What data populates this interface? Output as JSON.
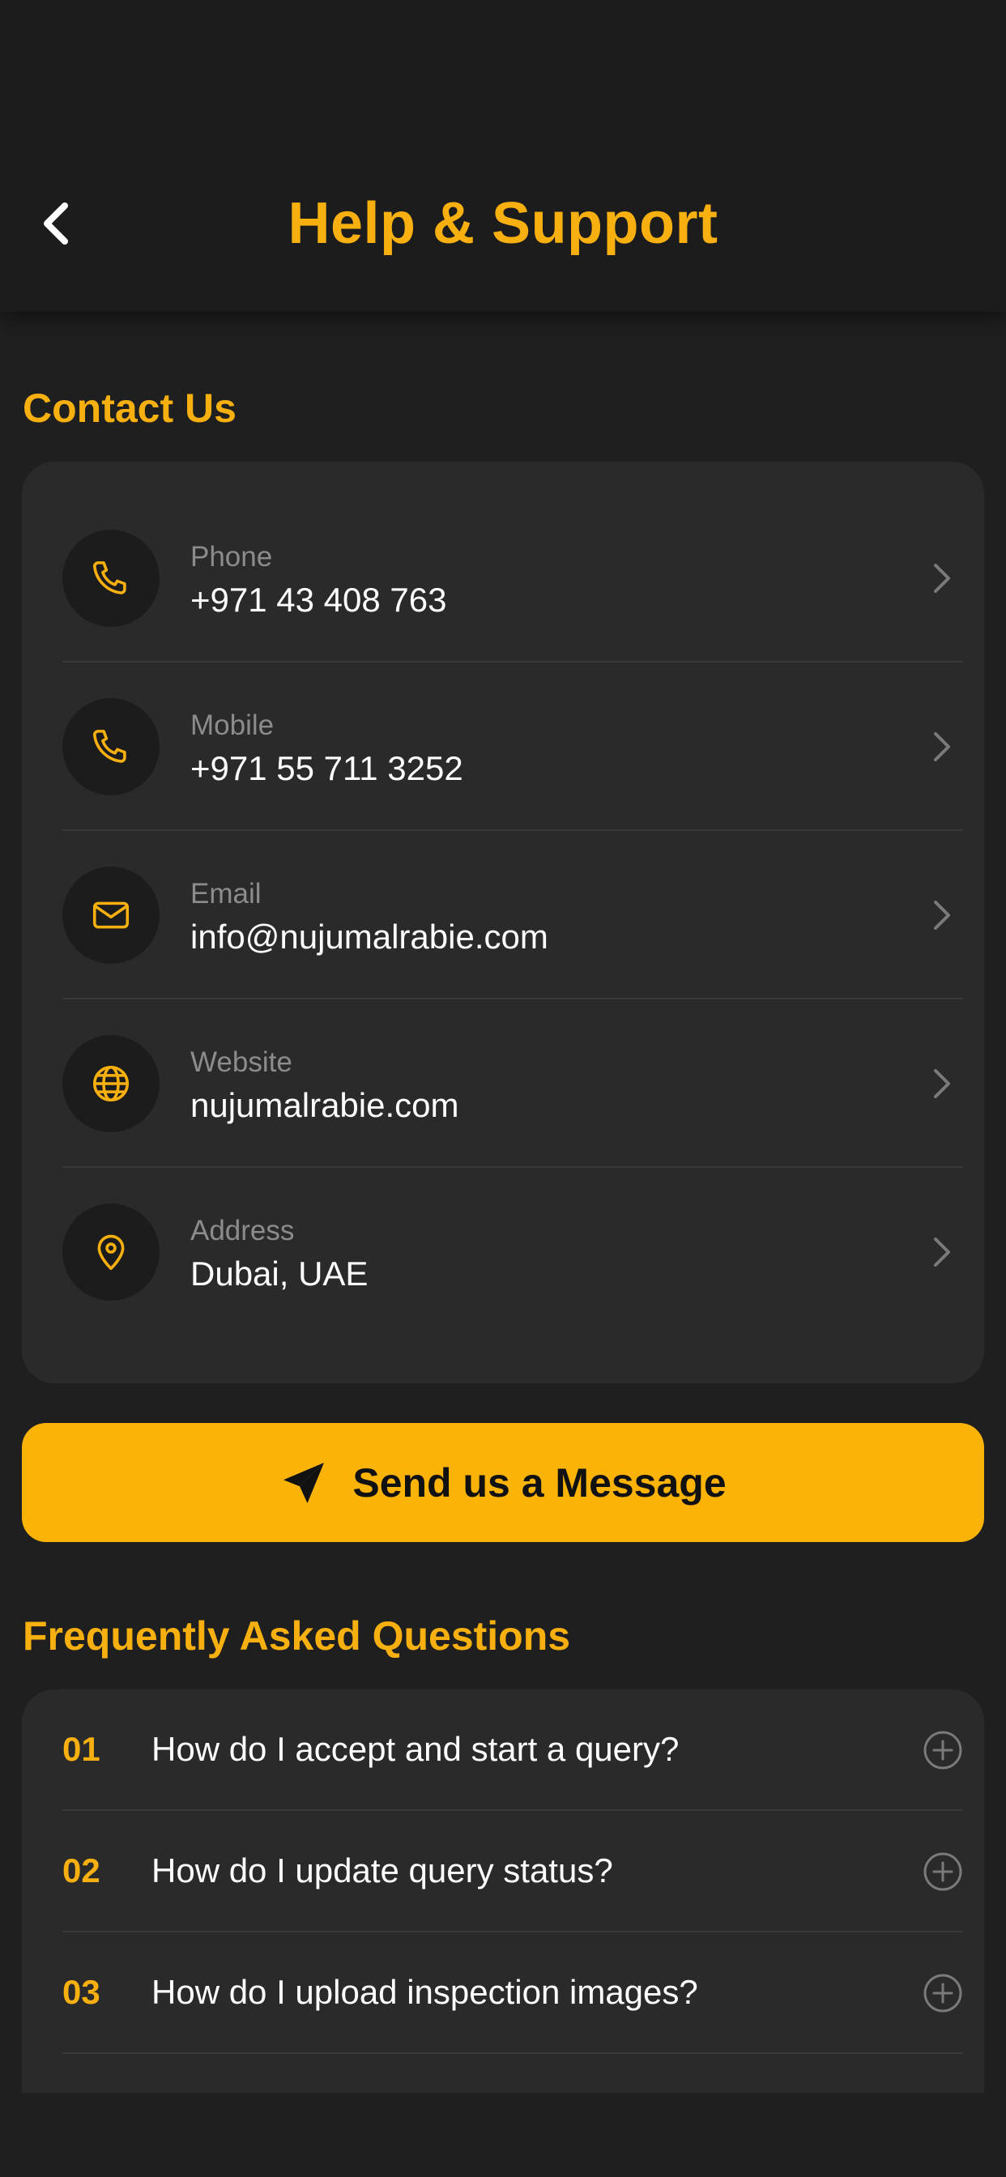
{
  "header": {
    "title": "Help & Support",
    "back_icon": "chevron-left-icon"
  },
  "contact": {
    "section_title": "Contact Us",
    "items": [
      {
        "label": "Phone",
        "value": "+971 43 408 763",
        "icon": "phone-icon"
      },
      {
        "label": "Mobile",
        "value": "+971 55 711 3252",
        "icon": "phone-icon"
      },
      {
        "label": "Email",
        "value": "info@nujumalrabie.com",
        "icon": "mail-icon"
      },
      {
        "label": "Website",
        "value": "nujumalrabie.com",
        "icon": "globe-icon"
      },
      {
        "label": "Address",
        "value": "Dubai, UAE",
        "icon": "location-pin-icon"
      }
    ]
  },
  "send_button": {
    "label": "Send us a Message",
    "icon": "send-icon"
  },
  "faq": {
    "section_title": "Frequently Asked Questions",
    "items": [
      {
        "number": "01",
        "question": "How do I accept and start a query?"
      },
      {
        "number": "02",
        "question": "How do I update query status?"
      },
      {
        "number": "03",
        "question": "How do I upload inspection images?"
      }
    ]
  },
  "colors": {
    "accent": "#f7b00f",
    "button": "#fbb308",
    "background": "#1f1f1f",
    "card": "#2a2a2a"
  }
}
